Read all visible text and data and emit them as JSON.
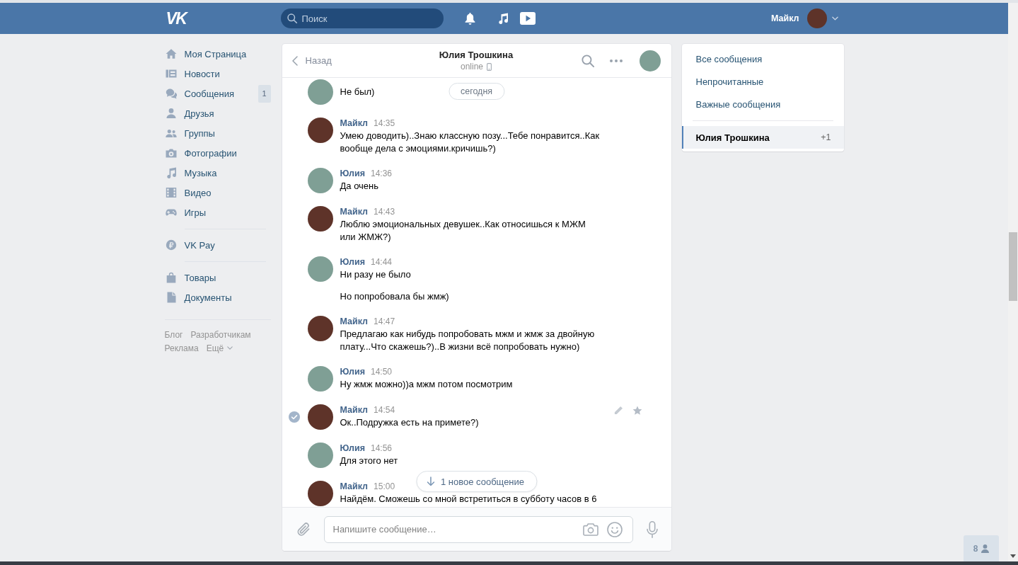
{
  "header": {
    "logo": "VK",
    "search": {
      "placeholder": "Поиск"
    },
    "user": {
      "name": "Майкл"
    }
  },
  "nav": {
    "sections": [
      {
        "items": [
          {
            "kind": "profile",
            "label": "Моя Страница"
          },
          {
            "kind": "news",
            "label": "Новости"
          },
          {
            "kind": "messages",
            "label": "Сообщения",
            "badge": "1"
          },
          {
            "kind": "friends",
            "label": "Друзья"
          },
          {
            "kind": "groups",
            "label": "Группы"
          },
          {
            "kind": "photos",
            "label": "Фотографии"
          },
          {
            "kind": "music",
            "label": "Музыка"
          },
          {
            "kind": "video",
            "label": "Видео"
          },
          {
            "kind": "games",
            "label": "Игры"
          }
        ]
      },
      {
        "items": [
          {
            "kind": "pay",
            "label": "VK Pay"
          }
        ]
      },
      {
        "items": [
          {
            "kind": "market",
            "label": "Товары"
          },
          {
            "kind": "docs",
            "label": "Документы"
          }
        ]
      }
    ],
    "footer": [
      [
        {
          "kind": "link",
          "label": "Блог"
        },
        {
          "kind": "link",
          "label": "Разработчикам"
        }
      ],
      [
        {
          "kind": "link",
          "label": "Реклама"
        },
        {
          "kind": "menu",
          "label": "Ещё"
        }
      ]
    ]
  },
  "chat": {
    "back": "Назад",
    "title": "Юлия Трошкина",
    "status": "online",
    "date_pill": "сегодня",
    "messages": [
      {
        "kind": "peer",
        "texts": [
          "Не был)"
        ],
        "hovered": false
      },
      {
        "kind": "own",
        "author": "Майкл",
        "time": "14:35",
        "texts": [
          "Умею доводить)..Знаю классную позу...Тебе понравится..Как вообще дела с эмоциями.кричишь?)"
        ],
        "hovered": false
      },
      {
        "kind": "peer",
        "author": "Юлия",
        "time": "14:36",
        "texts": [
          "Да очень"
        ],
        "hovered": false
      },
      {
        "kind": "own",
        "author": "Майкл",
        "time": "14:43",
        "texts": [
          "Люблю эмоциональных девушек..Как относишься к МЖМ или ЖМЖ?)"
        ],
        "hovered": false
      },
      {
        "kind": "peer",
        "author": "Юлия",
        "time": "14:44",
        "texts": [
          "Ни разу не было",
          "Но попробовала бы жмж)"
        ],
        "hovered": false
      },
      {
        "kind": "own",
        "author": "Майкл",
        "time": "14:47",
        "texts": [
          "Предлагаю как нибудь попробовать мжм и жмж за двойную плату...Что скажешь?)..В жизни всё попробовать нужно)"
        ],
        "hovered": false
      },
      {
        "kind": "peer",
        "author": "Юлия",
        "time": "14:50",
        "texts": [
          "Ну жмж можно))а мжм потом посмотрим"
        ],
        "hovered": false
      },
      {
        "kind": "own",
        "author": "Майкл",
        "time": "14:54",
        "texts": [
          "Ок..Подружка есть на примете?)"
        ],
        "hovered": true
      },
      {
        "kind": "peer",
        "author": "Юлия",
        "time": "14:56",
        "texts": [
          "Для этого нет"
        ],
        "hovered": false
      },
      {
        "kind": "own",
        "author": "Майкл",
        "time": "15:00",
        "texts": [
          "Найдём. Сможешь со мной встретиться в субботу часов в 6"
        ],
        "hovered": false
      }
    ],
    "new_messages_pill": "1 новое сообщение",
    "composer": {
      "placeholder": "Напишите сообщение…"
    }
  },
  "filters": {
    "items": [
      {
        "label": "Все сообщения",
        "selected": false
      },
      {
        "label": "Непрочитанные",
        "selected": false
      },
      {
        "label": "Важные сообщения",
        "selected": false
      }
    ],
    "conversations": [
      {
        "label": "Юлия Трошкина",
        "count": "+1",
        "selected": true
      }
    ]
  },
  "online_widget": {
    "count": "8"
  }
}
